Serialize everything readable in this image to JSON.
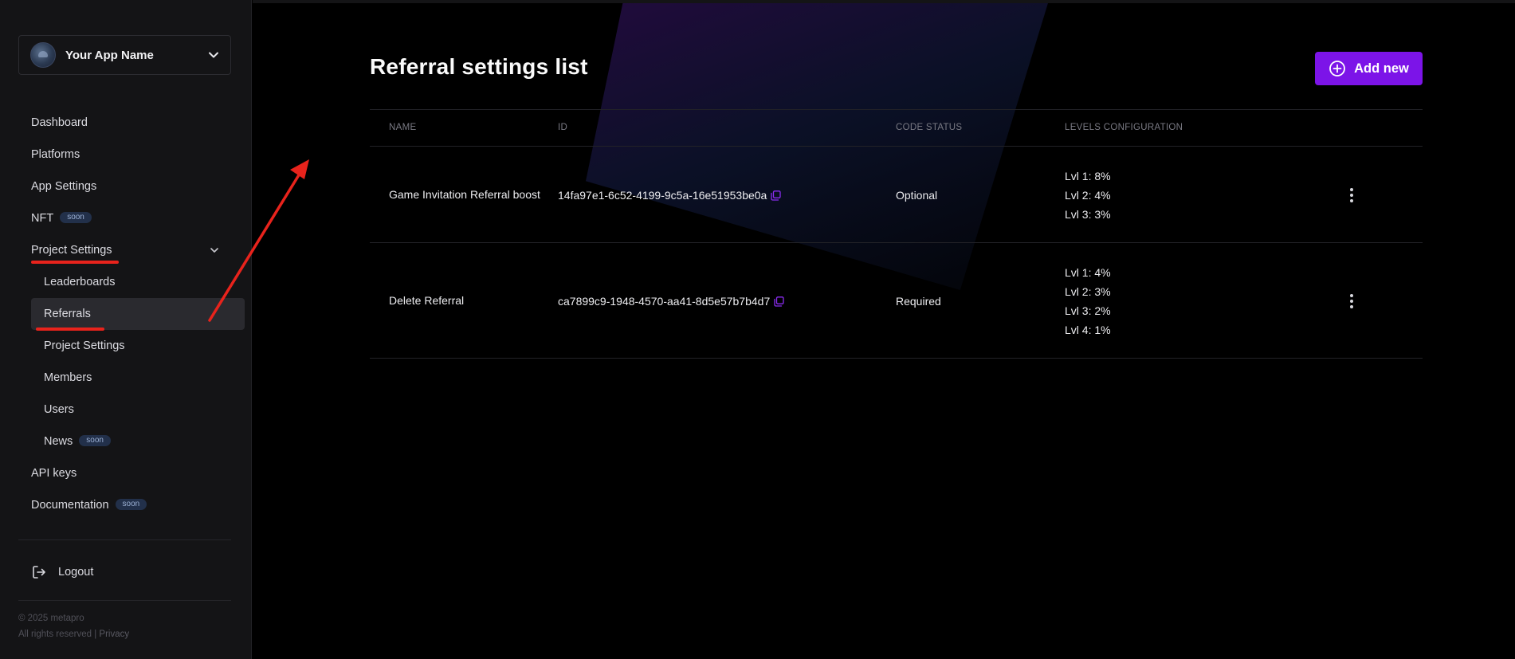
{
  "sidebar": {
    "app_name": "Your App Name",
    "items": [
      {
        "label": "Dashboard"
      },
      {
        "label": "Platforms"
      },
      {
        "label": "App Settings"
      },
      {
        "label": "NFT",
        "badge": "soon"
      },
      {
        "label": "Project Settings"
      },
      {
        "label": "Leaderboards"
      },
      {
        "label": "Referrals"
      },
      {
        "label": "Project Settings"
      },
      {
        "label": "Members"
      },
      {
        "label": "Users"
      },
      {
        "label": "News",
        "badge": "soon"
      },
      {
        "label": "API keys"
      },
      {
        "label": "Documentation",
        "badge": "soon"
      }
    ],
    "logout": "Logout",
    "footer": {
      "copyright": "© 2025 metapro",
      "rights": "All rights reserved | ",
      "privacy": "Privacy"
    }
  },
  "main": {
    "title": "Referral settings list",
    "add_button": "Add new",
    "table": {
      "headers": [
        "NAME",
        "ID",
        "CODE STATUS",
        "LEVELS CONFIGURATION"
      ],
      "rows": [
        {
          "name": "Game Invitation Referral boost",
          "id": "14fa97e1-6c52-4199-9c5a-16e51953be0a",
          "status": "Optional",
          "levels": [
            "Lvl 1: 8%",
            "Lvl 2: 4%",
            "Lvl 3: 3%"
          ]
        },
        {
          "name": "Delete Referral",
          "id": "ca7899c9-1948-4570-aa41-8d5e57b7b4d7",
          "status": "Required",
          "levels": [
            "Lvl 1: 4%",
            "Lvl 2: 3%",
            "Lvl 3: 2%",
            "Lvl 4: 1%"
          ]
        }
      ]
    }
  },
  "colors": {
    "accent": "#7c14e8",
    "annotation_red": "#e8231c",
    "sidebar_bg": "#141416",
    "active_item_bg": "#2a2a2f"
  }
}
